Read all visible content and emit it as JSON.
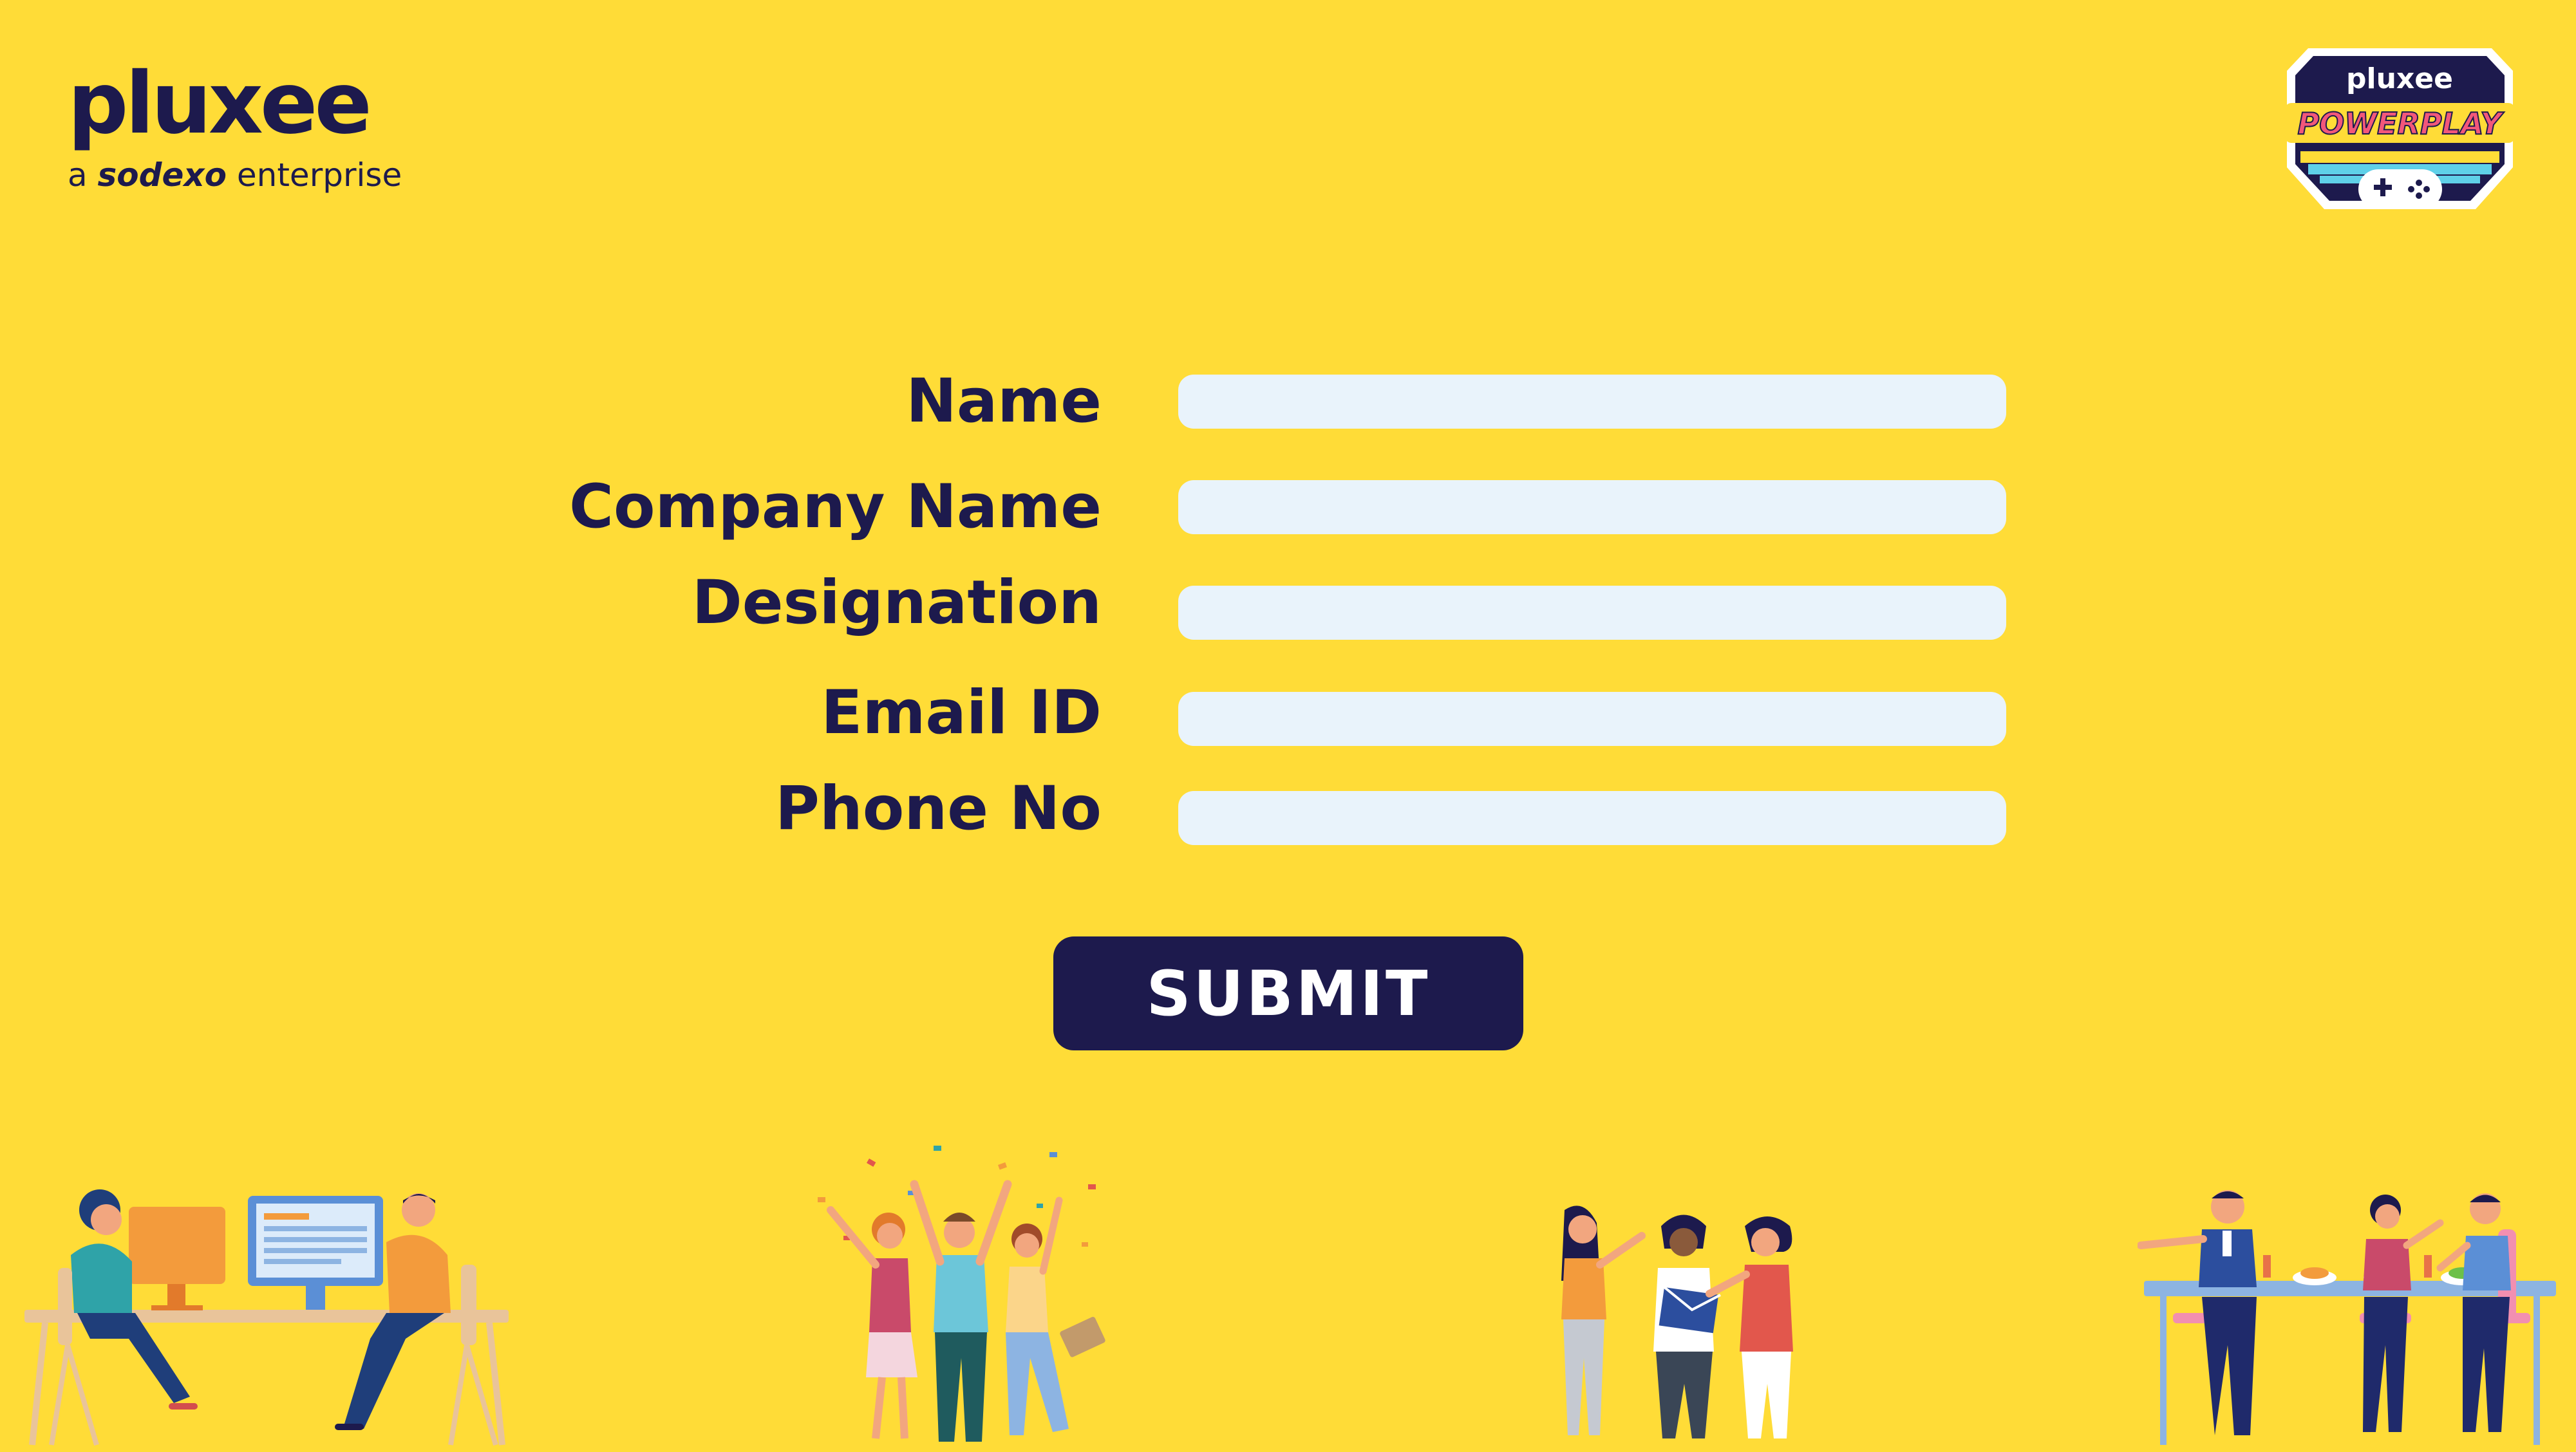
{
  "brand": {
    "name": "pluxee",
    "tagline_prefix": "a",
    "tagline_company": "sodexo",
    "tagline_suffix": "enterprise"
  },
  "badge": {
    "brand": "pluxee",
    "title": "POWERPLAY"
  },
  "form": {
    "fields": [
      {
        "label": "Name",
        "value": "",
        "placeholder": ""
      },
      {
        "label": "Company Name",
        "value": "",
        "placeholder": ""
      },
      {
        "label": "Designation",
        "value": "",
        "placeholder": ""
      },
      {
        "label": "Email ID",
        "value": "",
        "placeholder": ""
      },
      {
        "label": "Phone No",
        "value": "",
        "placeholder": ""
      }
    ],
    "submit_label": "SUBMIT"
  },
  "colors": {
    "background": "#FFDC37",
    "navy": "#1D1A4D",
    "field": "#E9F3FB"
  },
  "illustrations": [
    "office-workers",
    "celebrating-team",
    "team-collaboration",
    "team-dining"
  ]
}
